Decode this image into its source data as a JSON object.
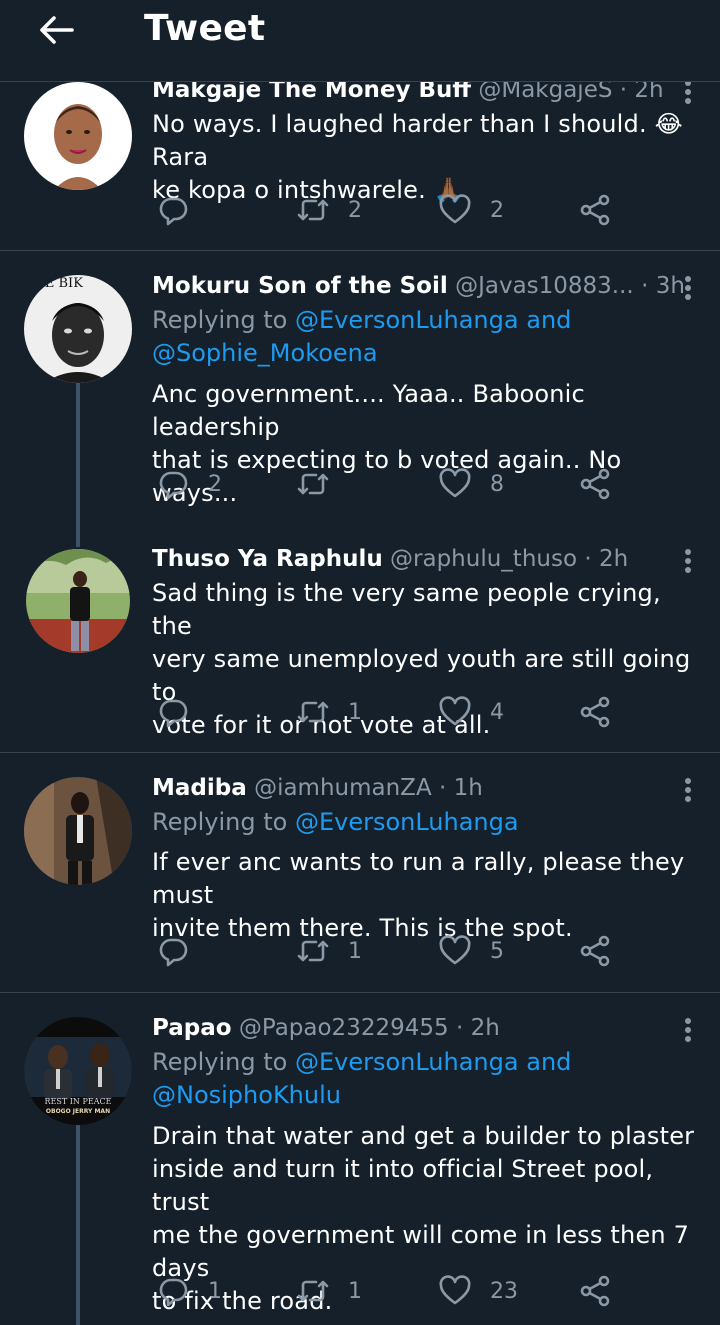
{
  "header": {
    "title": "Tweet"
  },
  "tweets": [
    {
      "name": "Makgaje The Money Buff",
      "handle": "@MakgajeS",
      "sep": "·",
      "time": "2h",
      "text_lines": [
        "No ways. I laughed harder than I should. 😂 Rara",
        "ke kopa o intshwarele. 🙏🏾"
      ],
      "replies": "",
      "retweets": "2",
      "likes": "2"
    },
    {
      "name": "Mokuru Son of the Soil",
      "handle": "@Javas10883...",
      "sep": "·",
      "time": "3h",
      "replying_prefix": "Replying to",
      "mention_1": "@EversonLuhanga",
      "replying_and": "and",
      "mention_2": "@Sophie_Mokoena",
      "text_lines": [
        "Anc government.... Yaaa.. Baboonic leadership",
        "that is expecting to b voted again.. No ways..."
      ],
      "replies": "2",
      "retweets": "",
      "likes": "8"
    },
    {
      "name": "Thuso Ya Raphulu",
      "handle": "@raphulu_thuso",
      "sep": "·",
      "time": "2h",
      "text_lines": [
        "Sad thing is the very same people crying, the",
        "very same unemployed youth are still going to",
        "vote for it or not vote at all."
      ],
      "replies": "",
      "retweets": "1",
      "likes": "4"
    },
    {
      "name": "Madiba",
      "handle": "@iamhumanZA",
      "sep": "·",
      "time": "1h",
      "replying_prefix": "Replying to",
      "mention_1": "@EversonLuhanga",
      "text_lines": [
        "If ever anc wants to run a rally, please they must",
        "invite them there. This is the spot."
      ],
      "replies": "",
      "retweets": "1",
      "likes": "5"
    },
    {
      "name": "Papao",
      "handle": "@Papao23229455",
      "sep": "·",
      "time": "2h",
      "replying_prefix": "Replying to",
      "mention_1": "@EversonLuhanga",
      "replying_and": "and",
      "mention_2": "@NosiphoKhulu",
      "text_lines": [
        "Drain that water and get a builder to plaster",
        "inside and turn it into official Street pool, trust",
        "me the government will come in less then 7 days",
        "to fix the road."
      ],
      "replies": "1",
      "retweets": "1",
      "likes": "23"
    }
  ],
  "avatars": {
    "t1": {
      "label": ""
    },
    "t2": {
      "label": "EVE BIK"
    },
    "t5": {
      "label_top": "REST IN PEACE",
      "label_bottom": "OBOGO    JERRY MAN"
    }
  },
  "colors": {
    "background": "#15202b",
    "divider": "#38444d",
    "secondary_text": "#8b98a5",
    "link": "#1d9bf0"
  },
  "icons": [
    "back-arrow-icon",
    "reply-icon",
    "retweet-icon",
    "like-icon",
    "share-icon",
    "more-icon"
  ]
}
